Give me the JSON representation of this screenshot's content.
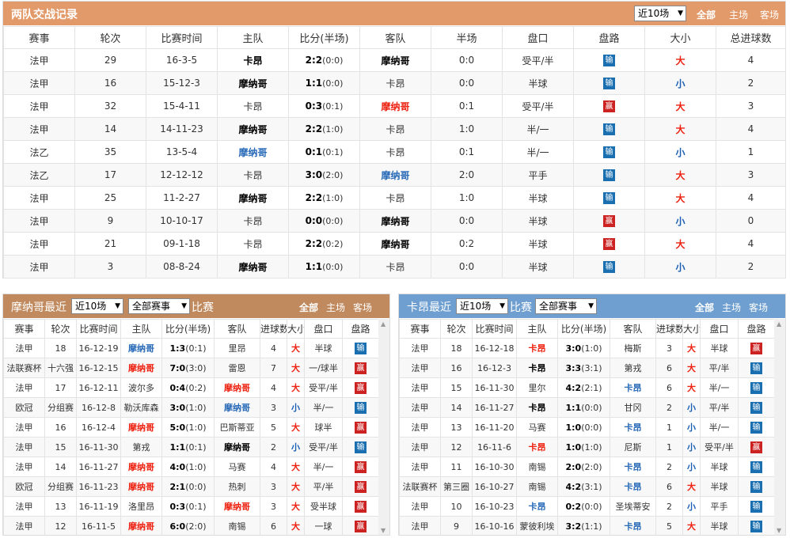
{
  "h2h": {
    "title": "两队交战记录",
    "select_label": "近10场",
    "filters": [
      "全部",
      "主场",
      "客场"
    ],
    "headers": [
      "赛事",
      "轮次",
      "比赛时间",
      "主队",
      "比分(半场)",
      "客队",
      "半场",
      "盘口",
      "盘路",
      "大小",
      "总进球数"
    ],
    "rows": [
      {
        "league": "法甲",
        "round": "29",
        "date": "16-3-5",
        "home": "卡昂",
        "home_style": "hl",
        "score": "2:2",
        "half": "(0:0)",
        "away": "摩纳哥",
        "away_style": "hl",
        "ht": "0:0",
        "handicap": "受平/半",
        "result": "输",
        "ou": "大",
        "total": "4"
      },
      {
        "league": "法甲",
        "round": "16",
        "date": "15-12-3",
        "home": "摩纳哥",
        "home_style": "hl",
        "score": "1:1",
        "half": "(0:0)",
        "away": "卡昂",
        "away_style": "",
        "ht": "0:0",
        "handicap": "半球",
        "result": "输",
        "ou": "小",
        "total": "2"
      },
      {
        "league": "法甲",
        "round": "32",
        "date": "15-4-11",
        "home": "卡昂",
        "home_style": "",
        "score": "0:3",
        "half": "(0:1)",
        "away": "摩纳哥",
        "away_style": "hl-red",
        "ht": "0:1",
        "handicap": "受平/半",
        "result": "赢",
        "ou": "大",
        "total": "3"
      },
      {
        "league": "法甲",
        "round": "14",
        "date": "14-11-23",
        "home": "摩纳哥",
        "home_style": "hl",
        "score": "2:2",
        "half": "(1:0)",
        "away": "卡昂",
        "away_style": "",
        "ht": "1:0",
        "handicap": "半/一",
        "result": "输",
        "ou": "大",
        "total": "4"
      },
      {
        "league": "法乙",
        "round": "35",
        "date": "13-5-4",
        "home": "摩纳哥",
        "home_style": "hl-blue",
        "score": "0:1",
        "half": "(0:1)",
        "away": "卡昂",
        "away_style": "",
        "ht": "0:1",
        "handicap": "半/一",
        "result": "输",
        "ou": "小",
        "total": "1"
      },
      {
        "league": "法乙",
        "round": "17",
        "date": "12-12-12",
        "home": "卡昂",
        "home_style": "",
        "score": "3:0",
        "half": "(2:0)",
        "away": "摩纳哥",
        "away_style": "hl-blue",
        "ht": "2:0",
        "handicap": "平手",
        "result": "输",
        "ou": "大",
        "total": "3"
      },
      {
        "league": "法甲",
        "round": "25",
        "date": "11-2-27",
        "home": "摩纳哥",
        "home_style": "hl",
        "score": "2:2",
        "half": "(1:0)",
        "away": "卡昂",
        "away_style": "",
        "ht": "1:0",
        "handicap": "半球",
        "result": "输",
        "ou": "大",
        "total": "4"
      },
      {
        "league": "法甲",
        "round": "9",
        "date": "10-10-17",
        "home": "卡昂",
        "home_style": "",
        "score": "0:0",
        "half": "(0:0)",
        "away": "摩纳哥",
        "away_style": "hl",
        "ht": "0:0",
        "handicap": "半球",
        "result": "赢",
        "ou": "小",
        "total": "0"
      },
      {
        "league": "法甲",
        "round": "21",
        "date": "09-1-18",
        "home": "卡昂",
        "home_style": "",
        "score": "2:2",
        "half": "(0:2)",
        "away": "摩纳哥",
        "away_style": "hl",
        "ht": "0:2",
        "handicap": "半球",
        "result": "赢",
        "ou": "大",
        "total": "4"
      },
      {
        "league": "法甲",
        "round": "3",
        "date": "08-8-24",
        "home": "摩纳哥",
        "home_style": "hl",
        "score": "1:1",
        "half": "(0:0)",
        "away": "卡昂",
        "away_style": "",
        "ht": "0:0",
        "handicap": "半球",
        "result": "输",
        "ou": "小",
        "total": "2"
      }
    ]
  },
  "monaco": {
    "title_prefix": "摩纳哥最近",
    "title_suffix": "比赛",
    "select_count": "近10场",
    "select_league": "全部赛事",
    "filters": [
      "全部",
      "主场",
      "客场"
    ],
    "headers": [
      "赛事",
      "轮次",
      "比赛时间",
      "主队",
      "比分(半场)",
      "客队",
      "进球数",
      "大小",
      "盘口",
      "盘路"
    ],
    "rows": [
      {
        "league": "法甲",
        "round": "18",
        "date": "16-12-19",
        "home": "摩纳哥",
        "home_style": "hl-blue",
        "score": "1:3",
        "half": "(0:1)",
        "away": "里昂",
        "away_style": "",
        "goals": "4",
        "ou": "大",
        "handicap": "半球",
        "result": "输"
      },
      {
        "league": "法联赛杯",
        "round": "十六强",
        "date": "16-12-15",
        "home": "摩纳哥",
        "home_style": "hl-red",
        "score": "7:0",
        "half": "(3:0)",
        "away": "雷恩",
        "away_style": "",
        "goals": "7",
        "ou": "大",
        "handicap": "一/球半",
        "result": "赢"
      },
      {
        "league": "法甲",
        "round": "17",
        "date": "16-12-11",
        "home": "波尔多",
        "home_style": "",
        "score": "0:4",
        "half": "(0:2)",
        "away": "摩纳哥",
        "away_style": "hl-red",
        "goals": "4",
        "ou": "大",
        "handicap": "受平/半",
        "result": "赢"
      },
      {
        "league": "欧冠",
        "round": "分组赛",
        "date": "16-12-8",
        "home": "勒沃库森",
        "home_style": "",
        "score": "3:0",
        "half": "(1:0)",
        "away": "摩纳哥",
        "away_style": "hl-blue",
        "goals": "3",
        "ou": "小",
        "handicap": "半/一",
        "result": "输"
      },
      {
        "league": "法甲",
        "round": "16",
        "date": "16-12-4",
        "home": "摩纳哥",
        "home_style": "hl-red",
        "score": "5:0",
        "half": "(1:0)",
        "away": "巴斯蒂亚",
        "away_style": "",
        "goals": "5",
        "ou": "大",
        "handicap": "球半",
        "result": "赢"
      },
      {
        "league": "法甲",
        "round": "15",
        "date": "16-11-30",
        "home": "第戎",
        "home_style": "",
        "score": "1:1",
        "half": "(0:1)",
        "away": "摩纳哥",
        "away_style": "hl",
        "goals": "2",
        "ou": "小",
        "handicap": "受平/半",
        "result": "输"
      },
      {
        "league": "法甲",
        "round": "14",
        "date": "16-11-27",
        "home": "摩纳哥",
        "home_style": "hl-red",
        "score": "4:0",
        "half": "(1:0)",
        "away": "马赛",
        "away_style": "",
        "goals": "4",
        "ou": "大",
        "handicap": "半/一",
        "result": "赢"
      },
      {
        "league": "欧冠",
        "round": "分组赛",
        "date": "16-11-23",
        "home": "摩纳哥",
        "home_style": "hl-red",
        "score": "2:1",
        "half": "(0:0)",
        "away": "热刺",
        "away_style": "",
        "goals": "3",
        "ou": "大",
        "handicap": "平/半",
        "result": "赢"
      },
      {
        "league": "法甲",
        "round": "13",
        "date": "16-11-19",
        "home": "洛里昂",
        "home_style": "",
        "score": "0:3",
        "half": "(0:1)",
        "away": "摩纳哥",
        "away_style": "hl-red",
        "goals": "3",
        "ou": "大",
        "handicap": "受半球",
        "result": "赢"
      },
      {
        "league": "法甲",
        "round": "12",
        "date": "16-11-5",
        "home": "摩纳哥",
        "home_style": "hl-red",
        "score": "6:0",
        "half": "(2:0)",
        "away": "南锡",
        "away_style": "",
        "goals": "6",
        "ou": "大",
        "handicap": "一球",
        "result": "赢"
      }
    ]
  },
  "caen": {
    "title_prefix": "卡昂最近",
    "title_suffix": "比赛",
    "select_count": "近10场",
    "select_league": "全部赛事",
    "filters": [
      "全部",
      "主场",
      "客场"
    ],
    "headers": [
      "赛事",
      "轮次",
      "比赛时间",
      "主队",
      "比分(半场)",
      "客队",
      "进球数",
      "大小",
      "盘口",
      "盘路"
    ],
    "rows": [
      {
        "league": "法甲",
        "round": "18",
        "date": "16-12-18",
        "home": "卡昂",
        "home_style": "hl-red",
        "score": "3:0",
        "half": "(1:0)",
        "away": "梅斯",
        "away_style": "",
        "goals": "3",
        "ou": "大",
        "handicap": "半球",
        "result": "赢"
      },
      {
        "league": "法甲",
        "round": "16",
        "date": "16-12-3",
        "home": "卡昂",
        "home_style": "hl",
        "score": "3:3",
        "half": "(3:1)",
        "away": "第戎",
        "away_style": "",
        "goals": "6",
        "ou": "大",
        "handicap": "平/半",
        "result": "输"
      },
      {
        "league": "法甲",
        "round": "15",
        "date": "16-11-30",
        "home": "里尔",
        "home_style": "",
        "score": "4:2",
        "half": "(2:1)",
        "away": "卡昂",
        "away_style": "hl-blue",
        "goals": "6",
        "ou": "大",
        "handicap": "半/一",
        "result": "输"
      },
      {
        "league": "法甲",
        "round": "14",
        "date": "16-11-27",
        "home": "卡昂",
        "home_style": "hl",
        "score": "1:1",
        "half": "(0:0)",
        "away": "甘冈",
        "away_style": "",
        "goals": "2",
        "ou": "小",
        "handicap": "平/半",
        "result": "输"
      },
      {
        "league": "法甲",
        "round": "13",
        "date": "16-11-20",
        "home": "马赛",
        "home_style": "",
        "score": "1:0",
        "half": "(0:0)",
        "away": "卡昂",
        "away_style": "hl-blue",
        "goals": "1",
        "ou": "小",
        "handicap": "半/一",
        "result": "输"
      },
      {
        "league": "法甲",
        "round": "12",
        "date": "16-11-6",
        "home": "卡昂",
        "home_style": "hl-red",
        "score": "1:0",
        "half": "(1:0)",
        "away": "尼斯",
        "away_style": "",
        "goals": "1",
        "ou": "小",
        "handicap": "受平/半",
        "result": "赢"
      },
      {
        "league": "法甲",
        "round": "11",
        "date": "16-10-30",
        "home": "南锡",
        "home_style": "",
        "score": "2:0",
        "half": "(2:0)",
        "away": "卡昂",
        "away_style": "hl-blue",
        "goals": "2",
        "ou": "小",
        "handicap": "半球",
        "result": "输"
      },
      {
        "league": "法联赛杯",
        "round": "第三圈",
        "date": "16-10-27",
        "home": "南锡",
        "home_style": "",
        "score": "4:2",
        "half": "(3:1)",
        "away": "卡昂",
        "away_style": "hl-blue",
        "goals": "6",
        "ou": "大",
        "handicap": "半球",
        "result": "输"
      },
      {
        "league": "法甲",
        "round": "10",
        "date": "16-10-23",
        "home": "卡昂",
        "home_style": "hl-blue",
        "score": "0:2",
        "half": "(0:0)",
        "away": "圣埃蒂安",
        "away_style": "",
        "goals": "2",
        "ou": "小",
        "handicap": "平手",
        "result": "输"
      },
      {
        "league": "法甲",
        "round": "9",
        "date": "16-10-16",
        "home": "蒙彼利埃",
        "home_style": "",
        "score": "3:2",
        "half": "(1:1)",
        "away": "卡昂",
        "away_style": "hl-blue",
        "goals": "5",
        "ou": "大",
        "handicap": "半球",
        "result": "输"
      }
    ]
  },
  "colors": {
    "orange_header": "#e39a6a",
    "brown_header": "#c08a5e",
    "blue_header": "#6f9fd0"
  }
}
